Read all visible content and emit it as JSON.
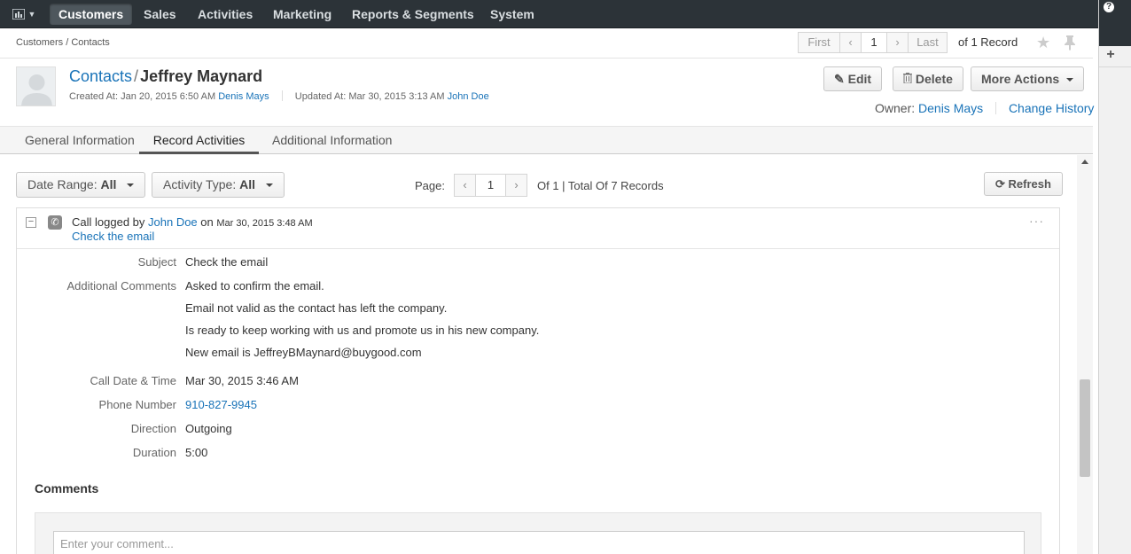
{
  "nav": {
    "items": [
      "Customers",
      "Sales",
      "Activities",
      "Marketing",
      "Reports & Segments",
      "System"
    ],
    "active": "Customers"
  },
  "breadcrumb": "Customers / Contacts",
  "pager": {
    "first": "First",
    "page": "1",
    "last": "Last",
    "info": "of 1 Record"
  },
  "header": {
    "entity": "Contacts",
    "separator": "/",
    "name": "Jeffrey Maynard",
    "created_label": "Created At: Jan 20, 2015 6:50 AM",
    "created_by": "Denis Mays",
    "updated_label": "Updated At: Mar 30, 2015 3:13 AM",
    "updated_by": "John Doe",
    "owner_label": "Owner:",
    "owner": "Denis Mays",
    "change_history": "Change History"
  },
  "actions": {
    "edit": "Edit",
    "delete": "Delete",
    "more": "More Actions"
  },
  "tabs": [
    "General Information",
    "Record Activities",
    "Additional Information"
  ],
  "active_tab": "Record Activities",
  "filters": {
    "date_range_label": "Date Range:",
    "date_range_value": "All",
    "activity_type_label": "Activity Type:",
    "activity_type_value": "All",
    "page_label": "Page:",
    "page": "1",
    "page_info": "Of 1 | Total Of 7 Records",
    "refresh": "Refresh"
  },
  "activity": {
    "prefix": "Call logged by",
    "user": "John Doe",
    "on": "on",
    "date": "Mar 30, 2015 3:48 AM",
    "subject_link": "Check the email",
    "fields": {
      "subject_label": "Subject",
      "subject": "Check the email",
      "comments_label": "Additional Comments",
      "comment_lines": [
        "Asked to confirm the email.",
        "Email not valid as the contact has left the company.",
        "Is ready to keep working with us and promote us in his new company.",
        "New email is JeffreyBMaynard@buygood.com"
      ],
      "call_date_label": "Call Date & Time",
      "call_date": "Mar 30, 2015 3:46 AM",
      "phone_label": "Phone Number",
      "phone": "910-827-9945",
      "direction_label": "Direction",
      "direction": "Outgoing",
      "duration_label": "Duration",
      "duration": "5:00"
    }
  },
  "comments": {
    "title": "Comments",
    "placeholder": "Enter your comment..."
  },
  "sidebar": {
    "help": "?",
    "add": "+"
  }
}
